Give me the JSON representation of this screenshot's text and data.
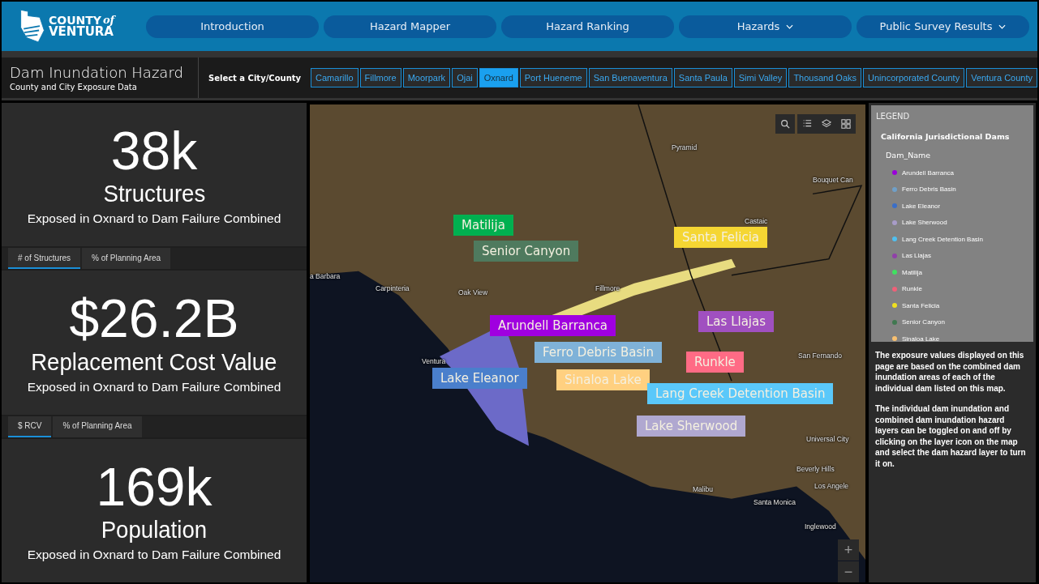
{
  "logo": {
    "line1": "COUNTY",
    "script": "of",
    "line2": "VENTURA"
  },
  "nav": [
    {
      "label": "Introduction",
      "has_menu": false
    },
    {
      "label": "Hazard Mapper",
      "has_menu": false
    },
    {
      "label": "Hazard Ranking",
      "has_menu": false
    },
    {
      "label": "Hazards",
      "has_menu": true
    },
    {
      "label": "Public Survey Results",
      "has_menu": true
    }
  ],
  "page_title": "Dam Inundation Hazard",
  "page_subtitle": "County and City Exposure Data",
  "city_select": {
    "label": "Select a City/County",
    "options": [
      {
        "label": "Camarillo",
        "selected": false
      },
      {
        "label": "Fillmore",
        "selected": false
      },
      {
        "label": "Moorpark",
        "selected": false
      },
      {
        "label": "Ojai",
        "selected": false
      },
      {
        "label": "Oxnard",
        "selected": true
      },
      {
        "label": "Port Hueneme",
        "selected": false
      },
      {
        "label": "San Buenaventura",
        "selected": false
      },
      {
        "label": "Santa Paula",
        "selected": false
      },
      {
        "label": "Simi Valley",
        "selected": false
      },
      {
        "label": "Thousand Oaks",
        "selected": false
      },
      {
        "label": "Unincorporated County",
        "selected": false
      },
      {
        "label": "Ventura County",
        "selected": false
      }
    ]
  },
  "stats": [
    {
      "value": "38k",
      "title": "Structures",
      "subtitle": "Exposed in Oxnard to Dam Failure Combined",
      "tabs": [
        {
          "label": "# of Structures",
          "selected": true
        },
        {
          "label": "% of Planning Area",
          "selected": false
        }
      ]
    },
    {
      "value": "$26.2B",
      "title": "Replacement Cost Value",
      "subtitle": "Exposed in Oxnard to Dam Failure Combined",
      "tabs": [
        {
          "label": "$ RCV",
          "selected": true
        },
        {
          "label": "% of Planning Area",
          "selected": false
        }
      ]
    },
    {
      "value": "169k",
      "title": "Population",
      "subtitle": "Exposed in Oxnard to Dam Failure Combined"
    }
  ],
  "map": {
    "place_labels": [
      "Pyramid",
      "Bouquet Can",
      "Castaic",
      "Fillmore",
      "Oak View",
      "Carpinteria",
      "a Barbara",
      "Ventura",
      "San Fernando",
      "Universal City",
      "Beverly Hills",
      "Los Angele",
      "Santa Monica",
      "Malibu",
      "Inglewood"
    ],
    "dam_labels": [
      {
        "name": "Matilija",
        "color": "#00b050"
      },
      {
        "name": "Senior Canyon",
        "color": "#4f7a5e"
      },
      {
        "name": "Santa Felicia",
        "color": "#f5d633"
      },
      {
        "name": "Arundell Barranca",
        "color": "#a000e0"
      },
      {
        "name": "Las Llajas",
        "color": "#a050c0"
      },
      {
        "name": "Ferro Debris Basin",
        "color": "#7fb2d8"
      },
      {
        "name": "Runkle",
        "color": "#ff6b85"
      },
      {
        "name": "Lake Eleanor",
        "color": "#4a7fcc"
      },
      {
        "name": "Sinaloa Lake",
        "color": "#ffd080"
      },
      {
        "name": "Lang Creek Detention Basin",
        "color": "#5ac8fa"
      },
      {
        "name": "Lake Sherwood",
        "color": "#b0a8d0"
      }
    ],
    "zoom_in": "+",
    "zoom_out": "−"
  },
  "legend": {
    "heading": "LEGEND",
    "layer": "California Jurisdictional Dams",
    "field": "Dam_Name",
    "items": [
      {
        "label": "Arundell Barranca",
        "color": "#9b00d8"
      },
      {
        "label": "Ferro Debris Basin",
        "color": "#6fa0c8"
      },
      {
        "label": "Lake Eleanor",
        "color": "#3a6ec8"
      },
      {
        "label": "Lake Sherwood",
        "color": "#a89cc8"
      },
      {
        "label": "Lang Creek Detention Basin",
        "color": "#50c0f0"
      },
      {
        "label": "Las Llajas",
        "color": "#9040a8"
      },
      {
        "label": "Matilija",
        "color": "#40e060"
      },
      {
        "label": "Runkle",
        "color": "#f06078"
      },
      {
        "label": "Santa Felicia",
        "color": "#f0e020"
      },
      {
        "label": "Senior Canyon",
        "color": "#407850"
      },
      {
        "label": "Sinaloa Lake",
        "color": "#f8c070"
      }
    ]
  },
  "notes": [
    "The exposure values displayed on this page are based on the combined dam inundation areas of each of the individual dam listed on this map.",
    "The individual dam inundation and combined dam inundation hazard layers can be toggled on and off by clicking on the layer icon on the map and select the dam hazard layer to turn it on."
  ]
}
